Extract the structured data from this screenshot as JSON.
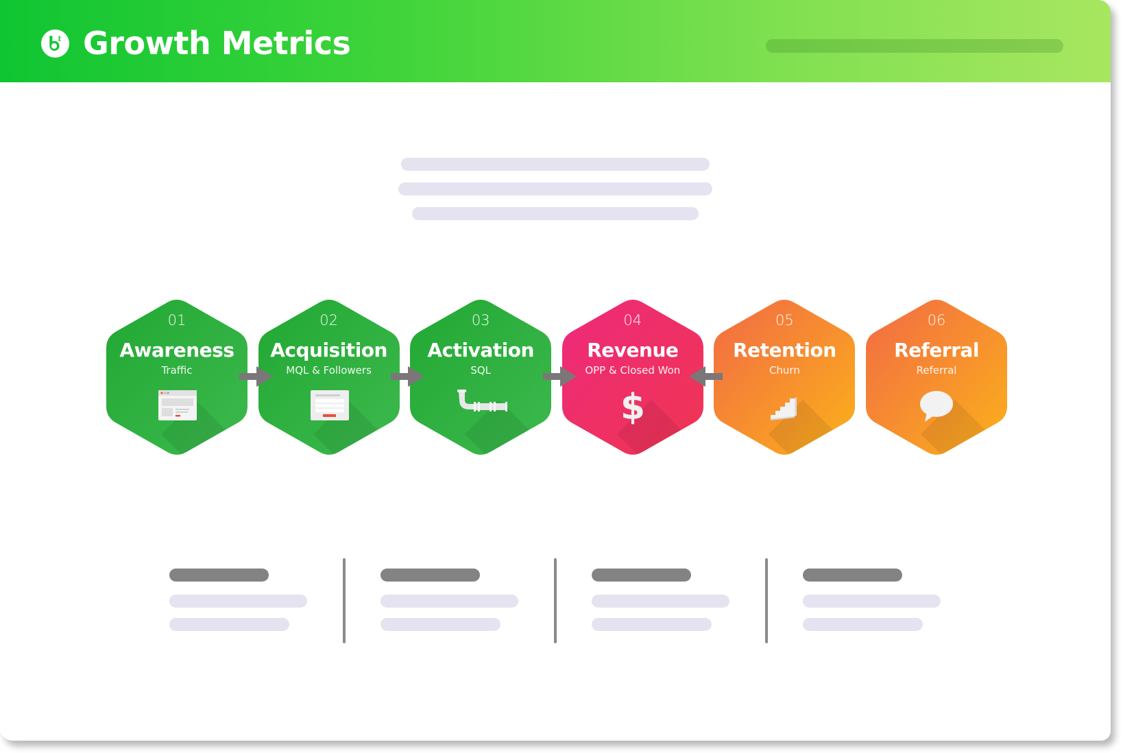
{
  "header": {
    "brand": "Growth Metrics",
    "logo_icon": "bt-logo-icon",
    "colors": {
      "gradient_start": "#0fc532",
      "gradient_end": "#a8e660"
    }
  },
  "intro_placeholder_lines": 3,
  "funnel": {
    "stages": [
      {
        "number": "01",
        "title": "Awareness",
        "subtitle": "Traffic",
        "icon": "browser-window-icon",
        "color_start": "#22a833",
        "color_end": "#3db94e"
      },
      {
        "number": "02",
        "title": "Acquisition",
        "subtitle": "MQL & Followers",
        "icon": "signup-form-icon",
        "color_start": "#22a833",
        "color_end": "#3db94e"
      },
      {
        "number": "03",
        "title": "Activation",
        "subtitle": "SQL",
        "icon": "pipe-icon",
        "color_start": "#22a833",
        "color_end": "#3db94e"
      },
      {
        "number": "04",
        "title": "Revenue",
        "subtitle": "OPP & Closed Won",
        "icon": "dollar-icon",
        "color_start": "#ee2a7b",
        "color_end": "#ef3552"
      },
      {
        "number": "05",
        "title": "Retention",
        "subtitle": "Churn",
        "icon": "stairs-icon",
        "color_start": "#f26a45",
        "color_end": "#fbb11a"
      },
      {
        "number": "06",
        "title": "Referral",
        "subtitle": "Referral",
        "icon": "speech-bubble-icon",
        "color_start": "#f26a45",
        "color_end": "#fbb11a"
      }
    ],
    "arrows": [
      {
        "from": "01",
        "to": "02",
        "direction": "right"
      },
      {
        "from": "02",
        "to": "03",
        "direction": "right"
      },
      {
        "from": "03",
        "to": "04",
        "direction": "right"
      },
      {
        "from": "05",
        "to": "04",
        "direction": "left"
      }
    ],
    "arrow_color": "#7b7778"
  },
  "summary_columns": 4
}
